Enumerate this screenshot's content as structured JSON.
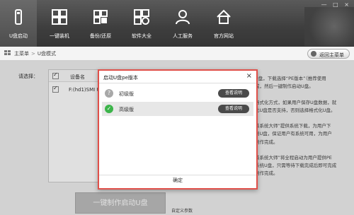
{
  "toolbar": {
    "items": [
      {
        "label": "U盘启动",
        "icon": "usb-drive-icon"
      },
      {
        "label": "一键装机",
        "icon": "windows-grid-icon"
      },
      {
        "label": "备份/还原",
        "icon": "backup-restore-icon"
      },
      {
        "label": "软件大全",
        "icon": "apps-grid-icon"
      },
      {
        "label": "人工服务",
        "icon": "support-person-icon"
      },
      {
        "label": "官方网站",
        "icon": "home-icon"
      }
    ],
    "window_controls": "— □ ×"
  },
  "breadcrumb": {
    "home": "主菜单",
    "separator": ">",
    "current": "U盘模式",
    "back_button": "返回主菜单"
  },
  "main": {
    "select_label": "请选择：",
    "table_header_device": "设备名",
    "table_row_device": "F:(hd1)SMI U",
    "right_text": [
      "U盘，下载选择“PE版本”（推荐使用",
      "成，然后一键制作启动U盘。",
      "",
      "格式化方式，如果用户保存U盘数据，就",
      "此U盘是否支持，否则选择格式化U盘。",
      "",
      "装系统大师”提供系统下载，为用户下",
      "到U盘，保证用户有系统可用，为用户",
      "制作完成。",
      "",
      "装系统大师”将全程启动为用户提供PE",
      "系统U盘，只需等待下载完成后即可完成",
      "制作完成。"
    ],
    "make_button": "一键制作启动U盘",
    "custom_params": "自定义参数"
  },
  "modal": {
    "title": "启动U盘pe版本",
    "close": "×",
    "options": [
      {
        "label": "初级版",
        "button": "查看说明",
        "status": "unselected"
      },
      {
        "label": "高级版",
        "button": "查看说明",
        "status": "selected"
      }
    ],
    "confirm": "确定"
  },
  "colors": {
    "modal_border": "#e0504a",
    "selected_icon": "#3cb44a",
    "toolbar_bg": "#3e3e3e"
  }
}
